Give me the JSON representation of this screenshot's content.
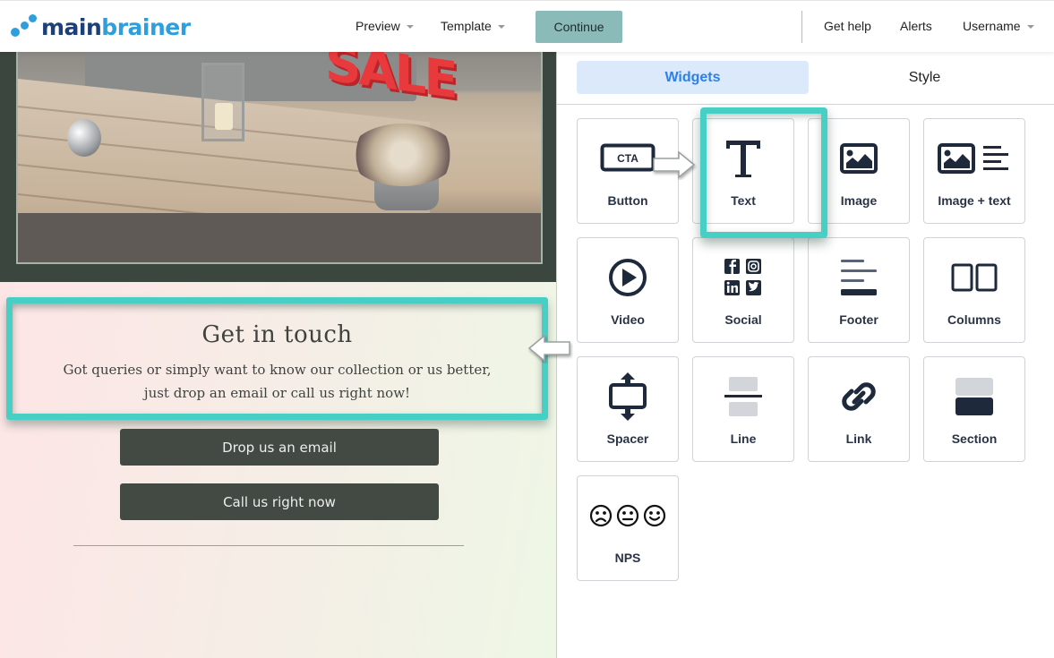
{
  "header": {
    "logo": {
      "part1": "main",
      "part2": "brainer"
    },
    "nav": [
      {
        "label": "Preview",
        "has_caret": true
      },
      {
        "label": "Template",
        "has_caret": true
      }
    ],
    "continue_label": "Continue",
    "right_nav": [
      {
        "label": "Get help"
      },
      {
        "label": "Alerts"
      },
      {
        "label": "Username",
        "has_caret": true
      }
    ]
  },
  "preview": {
    "image_text": "SALE",
    "contact": {
      "title": "Get in touch",
      "body_line1": "Got queries or simply want to know our collection or us better,",
      "body_line2": "just drop an email or call us right now!"
    },
    "buttons": [
      {
        "label": "Drop us an email"
      },
      {
        "label": "Call us right now"
      }
    ]
  },
  "panel": {
    "tabs": [
      {
        "label": "Widgets",
        "active": true
      },
      {
        "label": "Style",
        "active": false
      }
    ],
    "widgets": [
      {
        "label": "Button",
        "icon": "cta-button-icon",
        "icon_text": "CTA"
      },
      {
        "label": "Text",
        "icon": "text-icon",
        "highlighted": true
      },
      {
        "label": "Image",
        "icon": "image-icon"
      },
      {
        "label": "Image + text",
        "icon": "image-text-icon"
      },
      {
        "label": "Video",
        "icon": "video-play-icon"
      },
      {
        "label": "Social",
        "icon": "social-icons"
      },
      {
        "label": "Footer",
        "icon": "footer-icon"
      },
      {
        "label": "Columns",
        "icon": "columns-icon"
      },
      {
        "label": "Spacer",
        "icon": "spacer-icon"
      },
      {
        "label": "Line",
        "icon": "line-icon"
      },
      {
        "label": "Link",
        "icon": "link-icon"
      },
      {
        "label": "Section",
        "icon": "section-icon"
      },
      {
        "label": "NPS",
        "icon": "nps-faces-icon"
      }
    ]
  },
  "colors": {
    "highlight": "#48cfc5",
    "continue_bg": "#8bbbb8",
    "active_tab_bg": "#dbe9fb",
    "active_tab_text": "#2f80e6",
    "icon_dark": "#1e2a3b",
    "cta_bg": "#424a43",
    "logo_dark": "#1d3f7a",
    "logo_light": "#2e9fdc"
  }
}
